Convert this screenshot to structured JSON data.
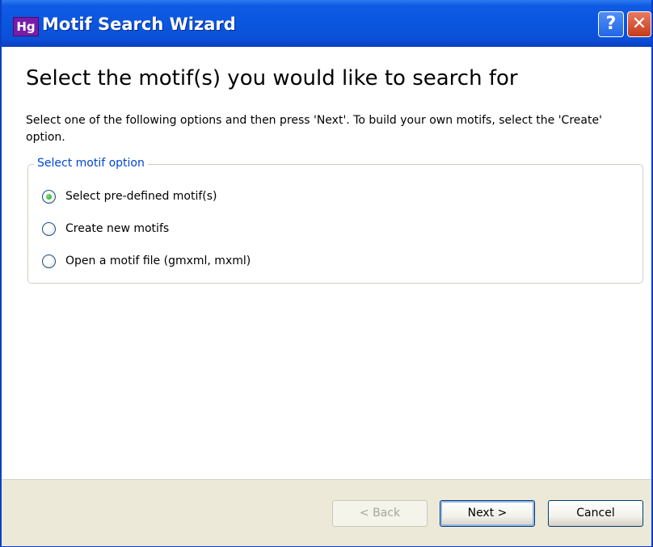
{
  "window": {
    "title": "Motif Search Wizard",
    "icon_text": "Hg",
    "help_glyph": "?",
    "close_glyph": "✕"
  },
  "content": {
    "heading": "Select the motif(s) you would like to search for",
    "instructions": "Select one of the following options and then press 'Next'. To build your own motifs, select the 'Create' option."
  },
  "group": {
    "label": "Select motif option",
    "options": [
      {
        "label": "Select pre-defined motif(s)",
        "checked": true
      },
      {
        "label": "Create new motifs",
        "checked": false
      },
      {
        "label": "Open a motif file (gmxml, mxml)",
        "checked": false
      }
    ]
  },
  "buttons": {
    "back_label": "< Back",
    "next_label": "Next >",
    "cancel_label": "Cancel"
  },
  "colors": {
    "titlebar": "#0a56df",
    "group_label": "#0046d5",
    "footer": "#ece9d8"
  }
}
